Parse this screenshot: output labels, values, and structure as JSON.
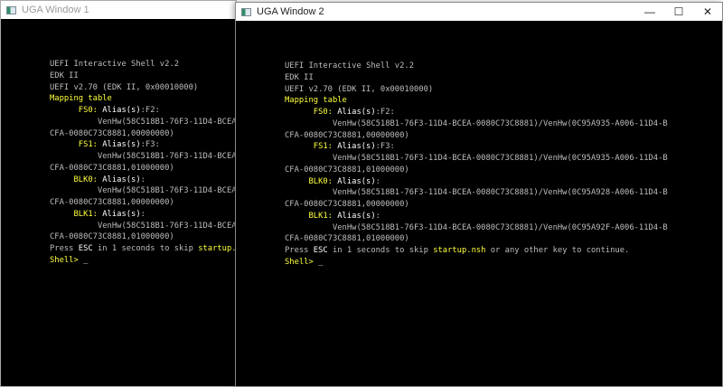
{
  "colors": {
    "gray": "#bdbdbd",
    "yellow": "#ffff3c",
    "white": "#ffffff"
  },
  "window1": {
    "title": "UGA Window 1"
  },
  "window2": {
    "title": "UGA Window 2",
    "minimize": "—",
    "maximize": "☐",
    "close": "✕"
  },
  "console": {
    "lines": [
      [
        {
          "t": "UEFI Interactive Shell v2.2",
          "c": "gray"
        }
      ],
      [
        {
          "t": "EDK II",
          "c": "gray"
        }
      ],
      [
        {
          "t": "UEFI v2.70 (EDK II, 0x00010000)",
          "c": "gray"
        }
      ],
      [
        {
          "t": "Mapping table",
          "c": "yellow"
        }
      ],
      [
        {
          "t": "      "
        },
        {
          "t": "FS0:",
          "c": "yellow"
        },
        {
          "t": " Alias(s)",
          "c": "white"
        },
        {
          "t": ":F2:",
          "c": "gray"
        }
      ],
      [
        {
          "t": "          VenHw(58C518B1-76F3-11D4-BCEA-0080C73C8881)/VenHw(0C95A935-A006-11D4-B",
          "c": "gray"
        }
      ],
      [
        {
          "t": "CFA-0080C73C8881,00000000)",
          "c": "gray"
        }
      ],
      [
        {
          "t": "      "
        },
        {
          "t": "FS1:",
          "c": "yellow"
        },
        {
          "t": " Alias(s)",
          "c": "white"
        },
        {
          "t": ":F3:",
          "c": "gray"
        }
      ],
      [
        {
          "t": "          VenHw(58C518B1-76F3-11D4-BCEA-0080C73C8881)/VenHw(0C95A935-A006-11D4-B",
          "c": "gray"
        }
      ],
      [
        {
          "t": "CFA-0080C73C8881,01000000)",
          "c": "gray"
        }
      ],
      [
        {
          "t": "     "
        },
        {
          "t": "BLK0:",
          "c": "yellow"
        },
        {
          "t": " Alias(s)",
          "c": "white"
        },
        {
          "t": ":",
          "c": "gray"
        }
      ],
      [
        {
          "t": "          VenHw(58C518B1-76F3-11D4-BCEA-0080C73C8881)/VenHw(0C95A928-A006-11D4-B",
          "c": "gray"
        }
      ],
      [
        {
          "t": "CFA-0080C73C8881,00000000)",
          "c": "gray"
        }
      ],
      [
        {
          "t": "     "
        },
        {
          "t": "BLK1:",
          "c": "yellow"
        },
        {
          "t": " Alias(s)",
          "c": "white"
        },
        {
          "t": ":",
          "c": "gray"
        }
      ],
      [
        {
          "t": "          VenHw(58C518B1-76F3-11D4-BCEA-0080C73C8881)/VenHw(0C95A92F-A006-11D4-B",
          "c": "gray"
        }
      ],
      [
        {
          "t": "CFA-0080C73C8881,01000000)",
          "c": "gray"
        }
      ],
      [
        {
          "t": "Press ",
          "c": "gray"
        },
        {
          "t": "ESC",
          "c": "white"
        },
        {
          "t": " in 1 seconds to skip ",
          "c": "gray"
        },
        {
          "t": "startup.nsh",
          "c": "yellow"
        },
        {
          "t": " or any other key to continue.",
          "c": "gray"
        }
      ],
      [
        {
          "t": "Shell> ",
          "c": "yellow"
        },
        {
          "t": "_",
          "c": "white"
        }
      ]
    ]
  }
}
